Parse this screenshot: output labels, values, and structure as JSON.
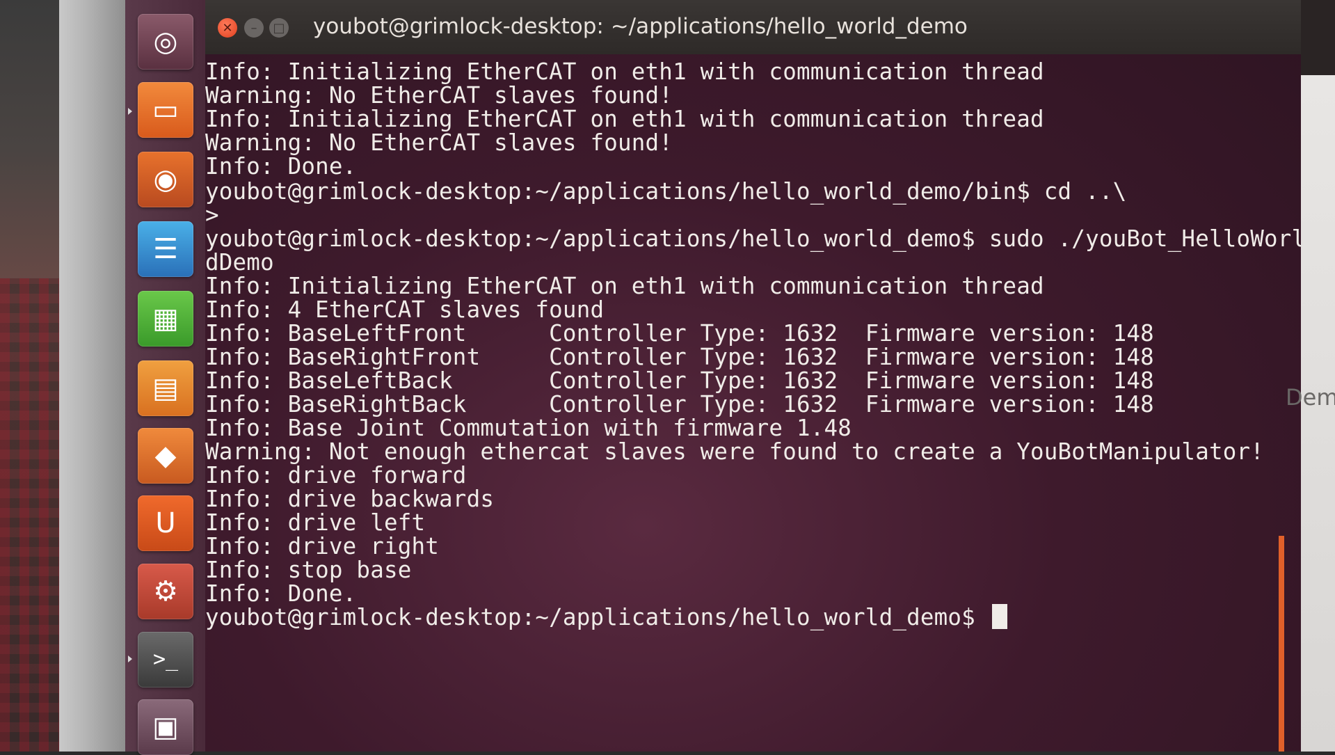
{
  "window": {
    "title": "youbot@grimlock-desktop: ~/applications/hello_world_demo",
    "close_glyph": "✕",
    "minimize_glyph": "–",
    "maximize_glyph": "□"
  },
  "launcher": {
    "items": [
      {
        "name": "dash",
        "icon": "ubuntu-logo-icon",
        "glyph": "◎"
      },
      {
        "name": "files",
        "icon": "folder-icon",
        "glyph": "▭"
      },
      {
        "name": "firefox",
        "icon": "firefox-icon",
        "glyph": "◉"
      },
      {
        "name": "writer",
        "icon": "document-icon",
        "glyph": "☰"
      },
      {
        "name": "calc",
        "icon": "spreadsheet-icon",
        "glyph": "▦"
      },
      {
        "name": "impress",
        "icon": "presentation-icon",
        "glyph": "▤"
      },
      {
        "name": "software-center",
        "icon": "shopping-bag-icon",
        "glyph": "◆"
      },
      {
        "name": "ubuntu-one",
        "icon": "ubuntu-one-icon",
        "glyph": "U"
      },
      {
        "name": "system-settings",
        "icon": "settings-icon",
        "glyph": "⚙"
      },
      {
        "name": "terminal",
        "icon": "terminal-icon",
        "glyph": ">_"
      },
      {
        "name": "workspace-switcher",
        "icon": "workspace-icon",
        "glyph": "▣"
      }
    ]
  },
  "terminal": {
    "lines": [
      "Info: Initializing EtherCAT on eth1 with communication thread",
      "Warning: No EtherCAT slaves found!",
      "Info: Initializing EtherCAT on eth1 with communication thread",
      "Warning: No EtherCAT slaves found!",
      "Info: Done.",
      "youbot@grimlock-desktop:~/applications/hello_world_demo/bin$ cd ..\\",
      ">",
      "youbot@grimlock-desktop:~/applications/hello_world_demo$ sudo ./youBot_HelloWorl",
      "dDemo",
      "Info: Initializing EtherCAT on eth1 with communication thread",
      "Info: 4 EtherCAT slaves found",
      "Info: BaseLeftFront      Controller Type: 1632  Firmware version: 148",
      "Info: BaseRightFront     Controller Type: 1632  Firmware version: 148",
      "Info: BaseLeftBack       Controller Type: 1632  Firmware version: 148",
      "Info: BaseRightBack      Controller Type: 1632  Firmware version: 148",
      "Info: Base Joint Commutation with firmware 1.48",
      "Warning: Not enough ethercat slaves were found to create a YouBotManipulator!",
      "Info: drive forward",
      "Info: drive backwards",
      "Info: drive left",
      "Info: drive right",
      "Info: stop base",
      "Info: Done.",
      "youbot@grimlock-desktop:~/applications/hello_world_demo$ "
    ]
  },
  "background_window": {
    "partial_text": "Demo"
  }
}
